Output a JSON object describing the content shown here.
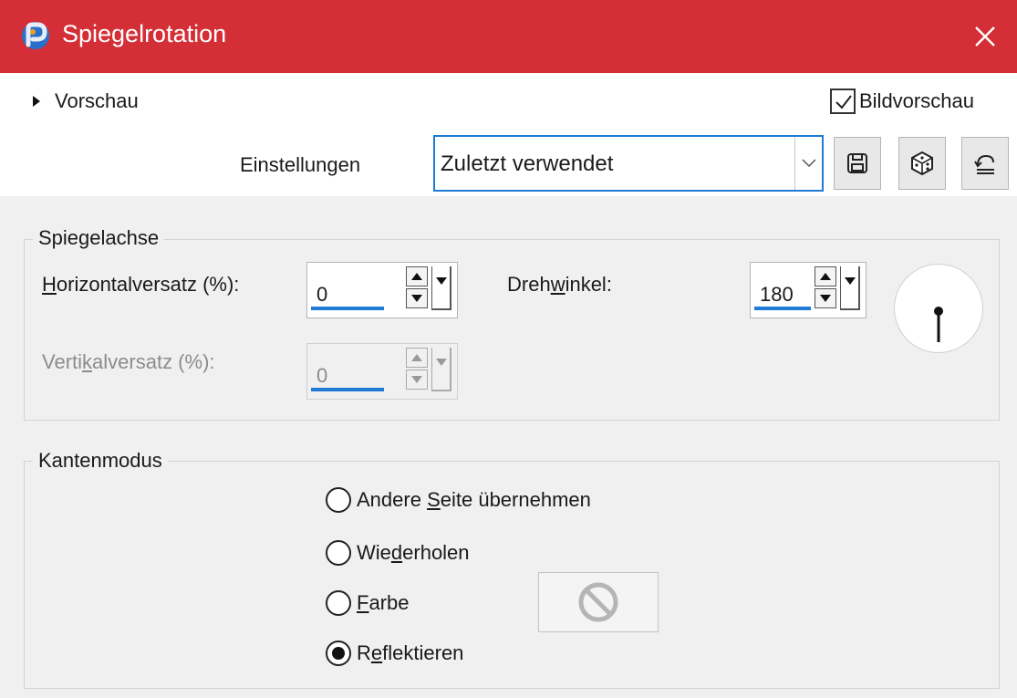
{
  "window": {
    "title": "Spiegelrotation",
    "close_icon": "close-icon",
    "accent_color": "#d42f36"
  },
  "preview": {
    "label": "Vorschau",
    "image_preview_label": "Bildvorschau",
    "image_preview_checked": true
  },
  "settings": {
    "label": "Einstellungen",
    "preset_value": "Zuletzt verwendet",
    "buttons": [
      "save-icon",
      "randomize-icon",
      "reset-icon"
    ]
  },
  "mirror_axis": {
    "group_title": "Spiegelachse",
    "horizontal": {
      "label_pre": "",
      "label_mnemonic": "H",
      "label_post": "orizontalversatz (%):",
      "value": "0"
    },
    "vertical": {
      "label_pre": "Verti",
      "label_mnemonic": "k",
      "label_post": "alversatz (%):",
      "value": "0",
      "disabled": true
    },
    "angle": {
      "label_pre": "Dreh",
      "label_mnemonic": "w",
      "label_post": "inkel:",
      "value": "180"
    }
  },
  "edge_mode": {
    "group_title": "Kantenmodus",
    "options": [
      {
        "pre": "Andere ",
        "mnemonic": "S",
        "post": "eite übernehmen",
        "checked": false
      },
      {
        "pre": "Wie",
        "mnemonic": "d",
        "post": "erholen",
        "checked": false
      },
      {
        "pre": "",
        "mnemonic": "F",
        "post": "arbe",
        "checked": false
      },
      {
        "pre": "R",
        "mnemonic": "e",
        "post": "flektieren",
        "checked": true
      }
    ],
    "color_button_icon": "no-color-icon"
  }
}
